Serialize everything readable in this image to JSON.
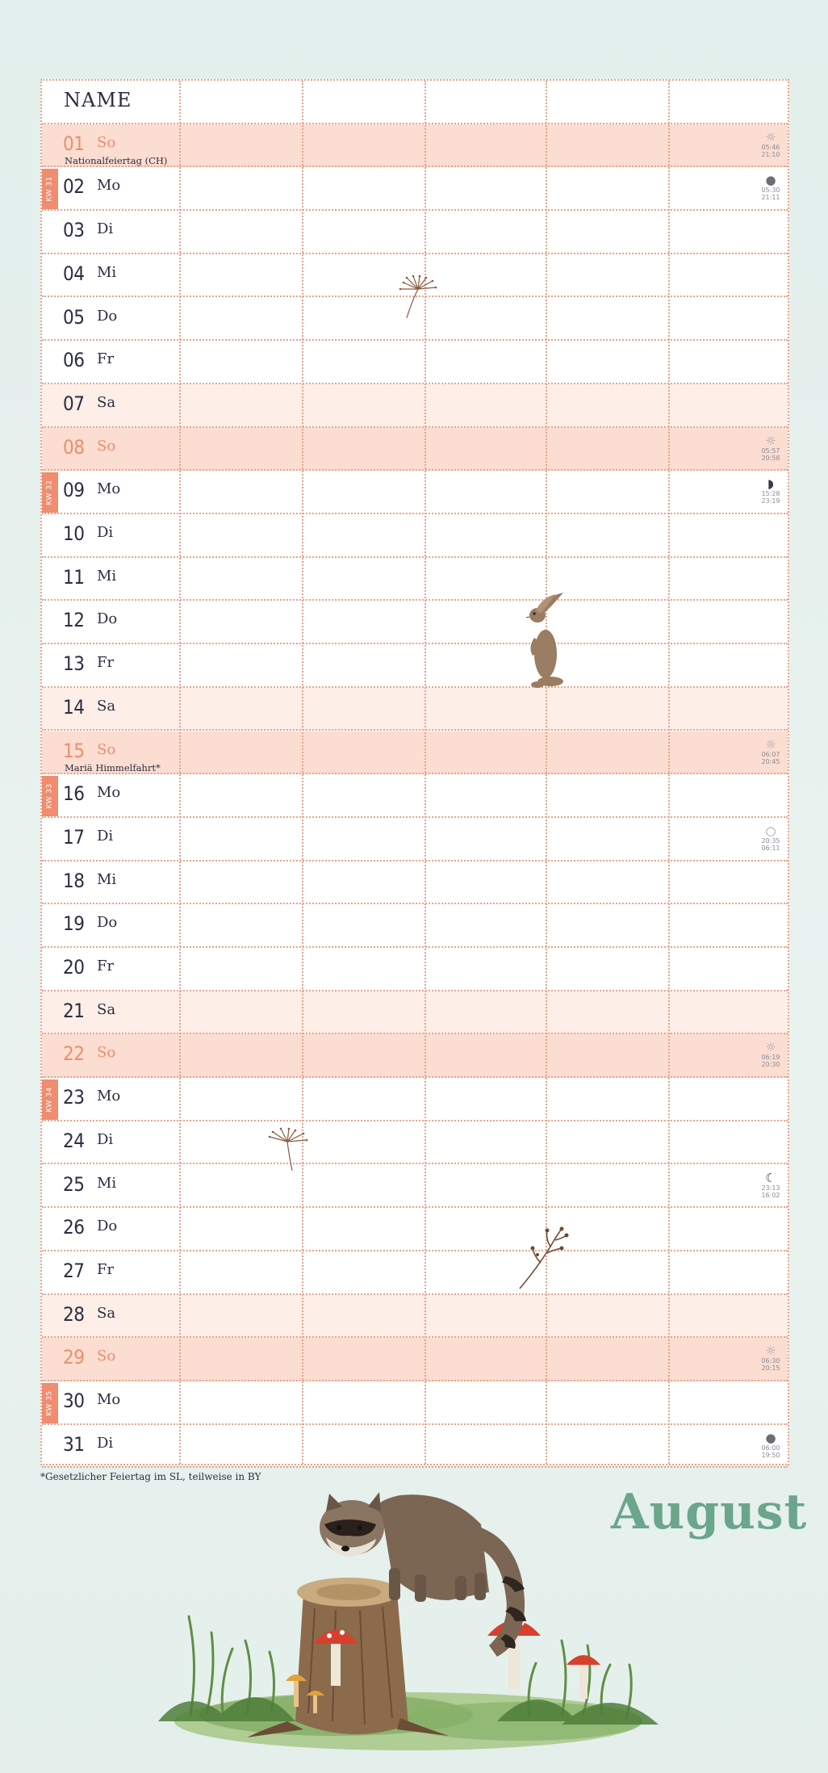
{
  "header": {
    "name_label": "NAME"
  },
  "days": [
    {
      "num": "01",
      "dow": "So",
      "type": "sunday",
      "holiday": "Nationalfeiertag (CH)",
      "kw": "",
      "info_icon": "sun-icon",
      "info_sym": "☼",
      "info_lines": [
        "05:46",
        "21:10"
      ]
    },
    {
      "num": "02",
      "dow": "Mo",
      "type": "weekday",
      "holiday": "",
      "kw": "KW 31",
      "info_icon": "full-moon-icon",
      "info_sym": "●",
      "info_lines": [
        "05:30",
        "21:11"
      ]
    },
    {
      "num": "03",
      "dow": "Di",
      "type": "weekday",
      "holiday": "",
      "kw": "",
      "info_icon": "",
      "info_sym": "",
      "info_lines": []
    },
    {
      "num": "04",
      "dow": "Mi",
      "type": "weekday",
      "holiday": "",
      "kw": "",
      "info_icon": "",
      "info_sym": "",
      "info_lines": []
    },
    {
      "num": "05",
      "dow": "Do",
      "type": "weekday",
      "holiday": "",
      "kw": "",
      "info_icon": "",
      "info_sym": "",
      "info_lines": []
    },
    {
      "num": "06",
      "dow": "Fr",
      "type": "weekday",
      "holiday": "",
      "kw": "",
      "info_icon": "",
      "info_sym": "",
      "info_lines": []
    },
    {
      "num": "07",
      "dow": "Sa",
      "type": "weekend",
      "holiday": "",
      "kw": "",
      "info_icon": "",
      "info_sym": "",
      "info_lines": []
    },
    {
      "num": "08",
      "dow": "So",
      "type": "sunday",
      "holiday": "",
      "kw": "",
      "info_icon": "sun-icon",
      "info_sym": "☼",
      "info_lines": [
        "05:57",
        "20:58"
      ]
    },
    {
      "num": "09",
      "dow": "Mo",
      "type": "weekday",
      "holiday": "",
      "kw": "KW 32",
      "info_icon": "last-quarter-moon-icon",
      "info_sym": "◗",
      "info_lines": [
        "15:28",
        "23:19"
      ]
    },
    {
      "num": "10",
      "dow": "Di",
      "type": "weekday",
      "holiday": "",
      "kw": "",
      "info_icon": "",
      "info_sym": "",
      "info_lines": []
    },
    {
      "num": "11",
      "dow": "Mi",
      "type": "weekday",
      "holiday": "",
      "kw": "",
      "info_icon": "",
      "info_sym": "",
      "info_lines": []
    },
    {
      "num": "12",
      "dow": "Do",
      "type": "weekday",
      "holiday": "",
      "kw": "",
      "info_icon": "",
      "info_sym": "",
      "info_lines": []
    },
    {
      "num": "13",
      "dow": "Fr",
      "type": "weekday",
      "holiday": "",
      "kw": "",
      "info_icon": "",
      "info_sym": "",
      "info_lines": []
    },
    {
      "num": "14",
      "dow": "Sa",
      "type": "weekend",
      "holiday": "",
      "kw": "",
      "info_icon": "",
      "info_sym": "",
      "info_lines": []
    },
    {
      "num": "15",
      "dow": "So",
      "type": "sunday",
      "holiday": "Mariä Himmelfahrt*",
      "kw": "",
      "info_icon": "sun-icon",
      "info_sym": "☼",
      "info_lines": [
        "06:07",
        "20:45"
      ]
    },
    {
      "num": "16",
      "dow": "Mo",
      "type": "weekday",
      "holiday": "",
      "kw": "KW 33",
      "info_icon": "",
      "info_sym": "",
      "info_lines": []
    },
    {
      "num": "17",
      "dow": "Di",
      "type": "weekday",
      "holiday": "",
      "kw": "",
      "info_icon": "new-moon-icon",
      "info_sym": "○",
      "info_lines": [
        "20:35",
        "06:11"
      ]
    },
    {
      "num": "18",
      "dow": "Mi",
      "type": "weekday",
      "holiday": "",
      "kw": "",
      "info_icon": "",
      "info_sym": "",
      "info_lines": []
    },
    {
      "num": "19",
      "dow": "Do",
      "type": "weekday",
      "holiday": "",
      "kw": "",
      "info_icon": "",
      "info_sym": "",
      "info_lines": []
    },
    {
      "num": "20",
      "dow": "Fr",
      "type": "weekday",
      "holiday": "",
      "kw": "",
      "info_icon": "",
      "info_sym": "",
      "info_lines": []
    },
    {
      "num": "21",
      "dow": "Sa",
      "type": "weekend",
      "holiday": "",
      "kw": "",
      "info_icon": "",
      "info_sym": "",
      "info_lines": []
    },
    {
      "num": "22",
      "dow": "So",
      "type": "sunday",
      "holiday": "",
      "kw": "",
      "info_icon": "sun-icon",
      "info_sym": "☼",
      "info_lines": [
        "06:19",
        "20:30"
      ]
    },
    {
      "num": "23",
      "dow": "Mo",
      "type": "weekday",
      "holiday": "",
      "kw": "KW 34",
      "info_icon": "",
      "info_sym": "",
      "info_lines": []
    },
    {
      "num": "24",
      "dow": "Di",
      "type": "weekday",
      "holiday": "",
      "kw": "",
      "info_icon": "",
      "info_sym": "",
      "info_lines": []
    },
    {
      "num": "25",
      "dow": "Mi",
      "type": "weekday",
      "holiday": "",
      "kw": "",
      "info_icon": "first-quarter-moon-icon",
      "info_sym": "☾",
      "info_lines": [
        "23:13",
        "16:02"
      ]
    },
    {
      "num": "26",
      "dow": "Do",
      "type": "weekday",
      "holiday": "",
      "kw": "",
      "info_icon": "",
      "info_sym": "",
      "info_lines": []
    },
    {
      "num": "27",
      "dow": "Fr",
      "type": "weekday",
      "holiday": "",
      "kw": "",
      "info_icon": "",
      "info_sym": "",
      "info_lines": []
    },
    {
      "num": "28",
      "dow": "Sa",
      "type": "weekend",
      "holiday": "",
      "kw": "",
      "info_icon": "",
      "info_sym": "",
      "info_lines": []
    },
    {
      "num": "29",
      "dow": "So",
      "type": "sunday",
      "holiday": "",
      "kw": "",
      "info_icon": "sun-icon",
      "info_sym": "☼",
      "info_lines": [
        "06:30",
        "20:15"
      ]
    },
    {
      "num": "30",
      "dow": "Mo",
      "type": "weekday",
      "holiday": "",
      "kw": "KW 35",
      "info_icon": "",
      "info_sym": "",
      "info_lines": []
    },
    {
      "num": "31",
      "dow": "Di",
      "type": "weekday",
      "holiday": "",
      "kw": "",
      "info_icon": "full-moon-icon",
      "info_sym": "●",
      "info_lines": [
        "06:00",
        "19:50"
      ]
    }
  ],
  "footnote": "*Gesetzlicher Feiertag im SL, teilweise in BY",
  "month": "August",
  "colors": {
    "accent": "#f08c70",
    "sunday_row": "#fbddd1",
    "saturday_row": "#fdeee7",
    "grid_dots": "#e6a48a",
    "month_title": "#6aa58c",
    "background": "#e6f1ee"
  },
  "illustrations": [
    "dandelion-seed-icon",
    "rabbit-icon",
    "dandelion-seed-icon",
    "twig-icon",
    "raccoon-icon",
    "tree-stump-icon",
    "mushroom-icon",
    "grass-icon"
  ]
}
